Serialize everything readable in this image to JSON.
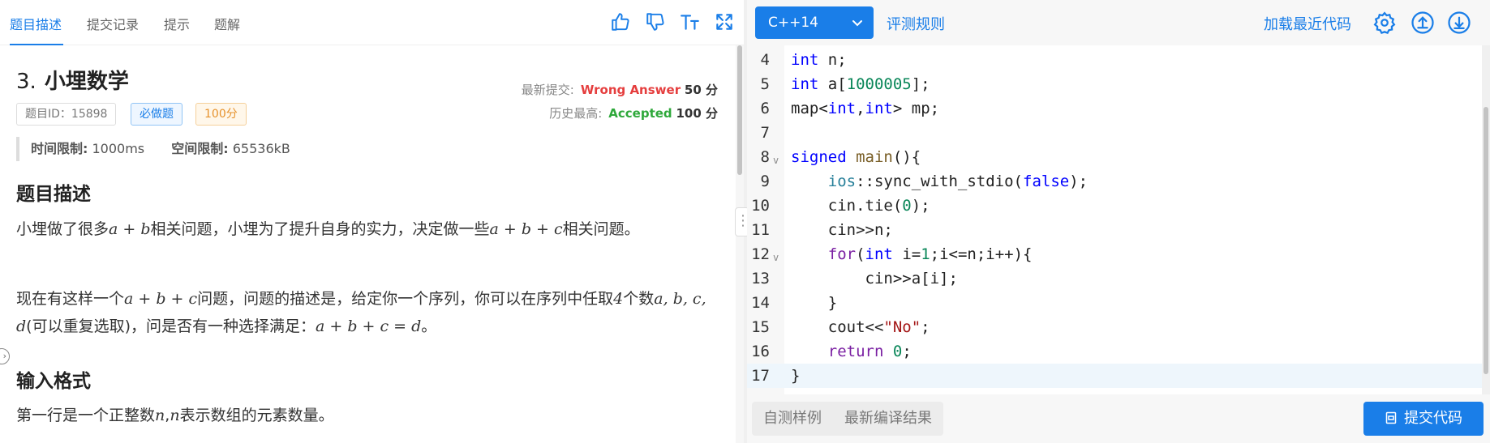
{
  "left_tabs": [
    "题目描述",
    "提交记录",
    "提示",
    "题解"
  ],
  "toolbar_icons": [
    "thumbs-up-icon",
    "thumbs-down-icon",
    "font-size-icon",
    "fullscreen-icon"
  ],
  "problem": {
    "number": "3.",
    "title": "小埋数学",
    "id_tag": "题目ID：15898",
    "required_tag": "必做题",
    "score_tag": "100分",
    "limits": {
      "time_label": "时间限制:",
      "time_value": "1000ms",
      "space_label": "空间限制:",
      "space_value": "65536kB"
    }
  },
  "submission": {
    "latest_label": "最新提交:",
    "latest_status": "Wrong Answer",
    "latest_score": "50 分",
    "best_label": "历史最高:",
    "best_status": "Accepted",
    "best_score": "100 分"
  },
  "sections": {
    "desc_heading": "题目描述",
    "desc_p1_a": "小埋做了很多",
    "desc_p1_math1": "a + b",
    "desc_p1_b": "相关问题，小埋为了提升自身的实力，决定做一些",
    "desc_p1_math2": "a + b + c",
    "desc_p1_c": "相关问题。",
    "desc_p2_a": "现在有这样一个",
    "desc_p2_math1": "a + b + c",
    "desc_p2_b": "问题，问题的描述是，给定你一个序列，你可以在序列中任取",
    "desc_p2_math2": "4",
    "desc_p2_c": "个数",
    "desc_p2_math3": "a, b, c, d",
    "desc_p2_d": "(可以重复选取)，问是否有一种选择满足：",
    "desc_p2_math4": "a + b + c = d",
    "desc_p2_e": "。",
    "input_heading": "输入格式",
    "input_p1_a": "第一行是一个正整数",
    "input_p1_math": "n",
    "input_p1_b": ",",
    "input_p1_math2": "n",
    "input_p1_c": "表示数组的元素数量。"
  },
  "editor": {
    "language": "C++14",
    "rules_link": "评测规则",
    "load_recent": "加载最近代码",
    "header_icons": [
      "settings-icon",
      "upload-icon",
      "download-icon"
    ],
    "current_line": 17,
    "lines": [
      {
        "n": "4",
        "fold": ""
      },
      {
        "n": "5",
        "fold": ""
      },
      {
        "n": "6",
        "fold": ""
      },
      {
        "n": "7",
        "fold": ""
      },
      {
        "n": "8",
        "fold": "v"
      },
      {
        "n": "9",
        "fold": ""
      },
      {
        "n": "10",
        "fold": ""
      },
      {
        "n": "11",
        "fold": ""
      },
      {
        "n": "12",
        "fold": "v"
      },
      {
        "n": "13",
        "fold": ""
      },
      {
        "n": "14",
        "fold": ""
      },
      {
        "n": "15",
        "fold": ""
      },
      {
        "n": "16",
        "fold": ""
      },
      {
        "n": "17",
        "fold": ""
      }
    ]
  },
  "bottom": {
    "tab_custom": "自测样例",
    "tab_compile": "最新编译结果",
    "submit": "提交代码"
  }
}
